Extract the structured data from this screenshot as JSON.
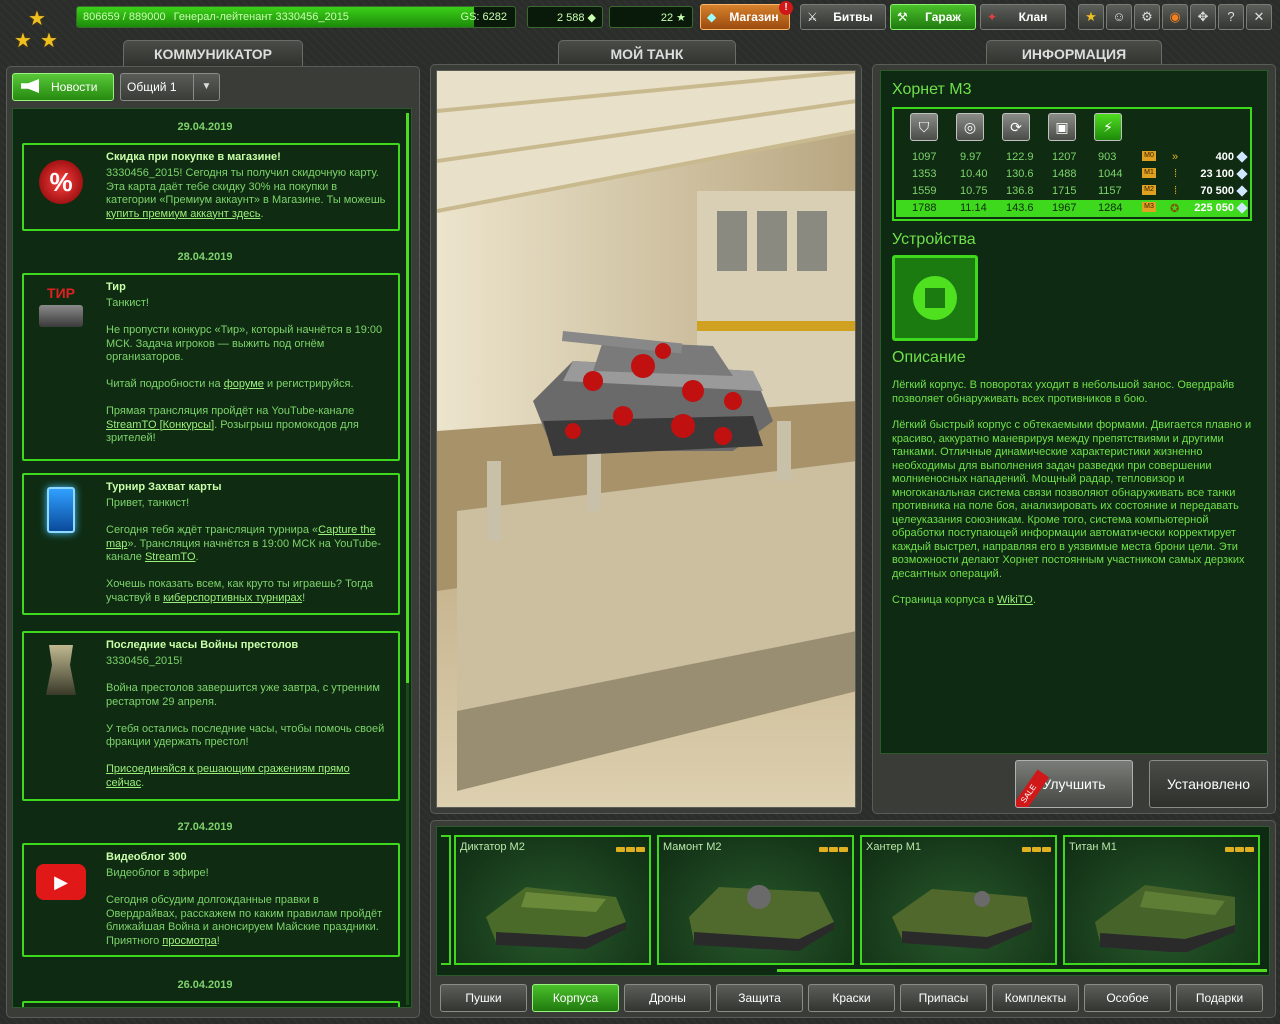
{
  "topbar": {
    "xp": "806659 / 889000",
    "rank_name": "Генерал-лейтенант 3330456_2015",
    "gs": "GS: 6282",
    "xp_progress": 0.907,
    "crystals": "2 588",
    "stars": "22",
    "shop_label": "Магазин",
    "shop_badge": "!",
    "battles_label": "Битвы",
    "garage_label": "Гараж",
    "clan_label": "Клан"
  },
  "communicator": {
    "title": "КОММУНИКАТОР",
    "news_button": "Новости",
    "channel": "Общий 1",
    "items": [
      {
        "date": "29.04.2019",
        "title": "Скидка при покупке в магазине!",
        "body": "3330456_2015! Сегодня ты получил скидочную карту. Эта карта даёт тебе скидку 30% на покупки в категории «Премиум аккаунт» в Магазине. Ты можешь ",
        "link": "купить премиум аккаунт здесь",
        "tail": "."
      },
      {
        "date": "28.04.2019",
        "title": "Тир",
        "p1": "Танкист!",
        "p2": "Не пропусти конкурс «Тир», который начнётся в 19:00 МСК. Задача игроков — выжить под огнём организаторов.",
        "p3a": "Читай подробности на ",
        "p3link": "форуме",
        "p3b": " и регистрируйся.",
        "p4a": "Прямая трансляция пройдёт на YouTube-канале ",
        "p4link": "StreamTO [Конкурсы]",
        "p4b": ". Розыгрыш промокодов для зрителей!"
      },
      {
        "title": "Турнир Захват карты",
        "p1": "Привет, танкист!",
        "p2a": " Сегодня тебя ждёт трансляция турнира «",
        "p2link": "Capture the map",
        "p2b": "». Трансляция начнётся в 19:00 МСК на YouTube-канале ",
        "p2link2": "StreamTO",
        "p2c": ".",
        "p3a": "Хочешь показать всем, как круто ты играешь? Тогда участвуй в ",
        "p3link": "киберспортивных турнирах",
        "p3b": "!"
      },
      {
        "title": "Последние часы Войны престолов",
        "p1": "3330456_2015!",
        "p2": "Война престолов завершится уже завтра, с утренним рестартом 29 апреля.",
        "p3": "У тебя остались последние часы, чтобы помочь своей фракции удержать престол!",
        "p4link": "Присоединяйся к решающим сражениям прямо сейчас",
        "p4b": "."
      },
      {
        "date": "27.04.2019",
        "title": "Видеоблог 300",
        "p1": "Видеоблог в эфире!",
        "p2a": "Сегодня обсудим долгожданные правки в Овердрайвах, расскажем по каким правилам пройдёт ближайшая Война и анонсируем Майские праздники. Приятного ",
        "p2link": "просмотра",
        "p2b": "!"
      },
      {
        "date": "26.04.2019"
      }
    ],
    "tir_icon_text": "ТИР"
  },
  "tank": {
    "title": "МОЙ ТАНК"
  },
  "info": {
    "title": "ИНФОРМАЦИЯ",
    "hull_name": "Хорнет М3",
    "stat_icons": [
      "armor-icon",
      "speed-icon",
      "turn-speed-icon",
      "weight-icon",
      "power-icon"
    ],
    "rows": [
      {
        "v": [
          "1097",
          "9.97",
          "122.9",
          "1207",
          "903"
        ],
        "mk": "M0",
        "rank": "»",
        "price": "400",
        "current": false
      },
      {
        "v": [
          "1353",
          "10.40",
          "130.6",
          "1488",
          "1044"
        ],
        "mk": "M1",
        "rank": "⁞",
        "price": "23 100",
        "current": false
      },
      {
        "v": [
          "1559",
          "10.75",
          "136.8",
          "1715",
          "1157"
        ],
        "mk": "M2",
        "rank": "⁞",
        "price": "70 500",
        "current": false
      },
      {
        "v": [
          "1788",
          "11.14",
          "143.6",
          "1967",
          "1284"
        ],
        "mk": "M3",
        "rank": "✪",
        "price": "225 050",
        "current": true
      }
    ],
    "devices_title": "Устройства",
    "desc_title": "Описание",
    "desc_p1": "Лёгкий корпус. В поворотах уходит в небольшой занос. Овердрайв позволяет обнаруживать всех противников в бою.",
    "desc_p2": "Лёгкий быстрый корпус с обтекаемыми формами. Двигается плавно и красиво, аккуратно маневрируя между препятствиями и другими танками. Отличные динамические характеристики жизненно необходимы для выполнения задач разведки при совершении молниеносных нападений. Мощный радар, тепловизор и многоканальная система связи позволяют обнаруживать все танки противника на поле боя, анализировать их состояние и передавать целеуказания союзникам. Кроме того, система компьютерной обработки поступающей информации автоматически корректирует каждый выстрел, направляя его в уязвимые места брони цели. Эти возможности делают Хорнет постоянным участником самых дерзких десантных операций.",
    "desc_p3a": "Страница корпуса в ",
    "desc_p3link": "WikiTO",
    "desc_p3b": ".",
    "upgrade_label": "Улучшить",
    "sale_label": "SALE",
    "installed_label": "Установлено"
  },
  "carousel": [
    {
      "name": "Диктатор М2",
      "stars": 3
    },
    {
      "name": "Мамонт М2",
      "stars": 3
    },
    {
      "name": "Хантер М1",
      "stars": 3
    },
    {
      "name": "Титан М1",
      "stars": 3
    }
  ],
  "categories": [
    "Пушки",
    "Корпуса",
    "Дроны",
    "Защита",
    "Краски",
    "Припасы",
    "Комплекты",
    "Особое",
    "Подарки"
  ],
  "active_category": "Корпуса",
  "colors": {
    "accent": "#3ed81c",
    "panel": "#0e2a12",
    "text": "#7dd36a"
  }
}
